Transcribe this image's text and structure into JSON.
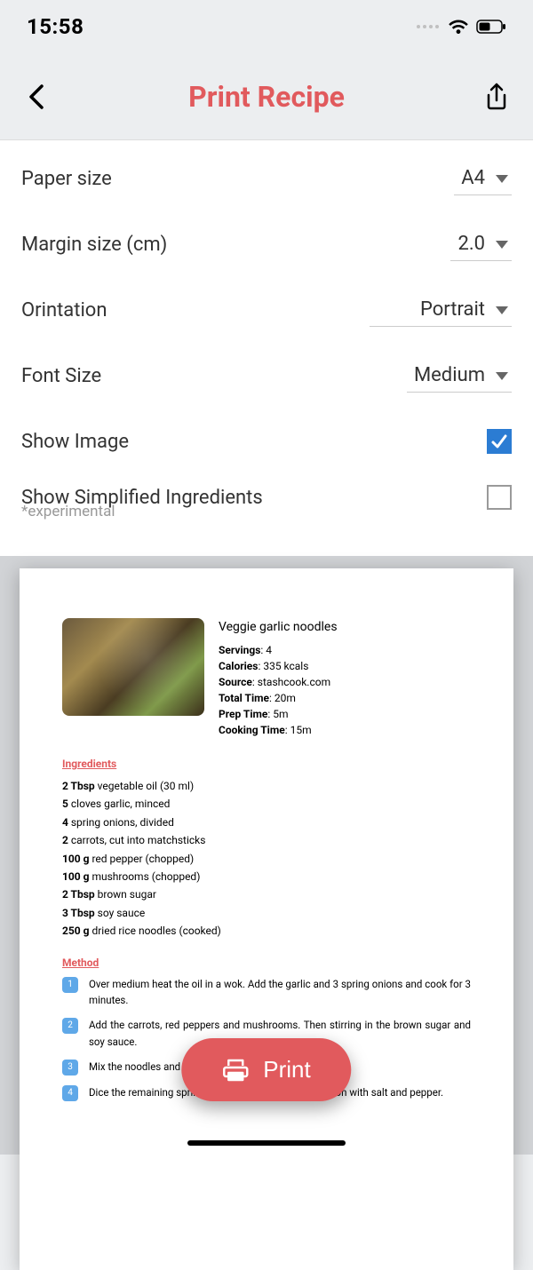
{
  "status": {
    "time": "15:58"
  },
  "header": {
    "title": "Print Recipe"
  },
  "settings": {
    "paper_size": {
      "label": "Paper size",
      "value": "A4"
    },
    "margin": {
      "label": "Margin size (cm)",
      "value": "2.0"
    },
    "orientation": {
      "label": "Orintation",
      "value": "Portrait"
    },
    "font_size": {
      "label": "Font Size",
      "value": "Medium"
    },
    "show_image": {
      "label": "Show Image",
      "checked": true
    },
    "show_simplified": {
      "label": "Show Simplified Ingredients",
      "sub": "*experimental",
      "checked": false
    }
  },
  "preview": {
    "title": "Veggie garlic noodles",
    "meta": {
      "servings_label": "Servings",
      "servings": "4",
      "calories_label": "Calories",
      "calories": "335 kcals",
      "source_label": "Source",
      "source": "stashcook.com",
      "total_label": "Total Time",
      "total": "20m",
      "prep_label": "Prep Time",
      "prep": "5m",
      "cook_label": "Cooking Time",
      "cook": "15m"
    },
    "ingredients_heading": "Ingredients",
    "ingredients": [
      {
        "qty": "2 Tbsp",
        "rest": " vegetable oil (30 ml)"
      },
      {
        "qty": "5",
        "rest": " cloves garlic, minced"
      },
      {
        "qty": "4",
        "rest": " spring onions, divided"
      },
      {
        "qty": "2",
        "rest": " carrots, cut into matchsticks"
      },
      {
        "qty": "100 g",
        "rest": " red pepper (chopped)"
      },
      {
        "qty": "100 g",
        "rest": " mushrooms (chopped)"
      },
      {
        "qty": "2 Tbsp",
        "rest": " brown sugar"
      },
      {
        "qty": "3 Tbsp",
        "rest": " soy sauce"
      },
      {
        "qty": "250 g",
        "rest": " dried rice noodles (cooked)"
      }
    ],
    "method_heading": "Method",
    "method": [
      "Over medium heat the oil in a wok. Add the garlic and 3 spring onions and cook for 3 minutes.",
      "Add the carrots, red peppers and mushrooms. Then stirring in the brown sugar and soy sauce.",
      "Mix the noodles and cook for another 4 minutes.",
      "Dice the remaining spring onion and top to serve. Season with salt and pepper."
    ]
  },
  "print_button": "Print"
}
